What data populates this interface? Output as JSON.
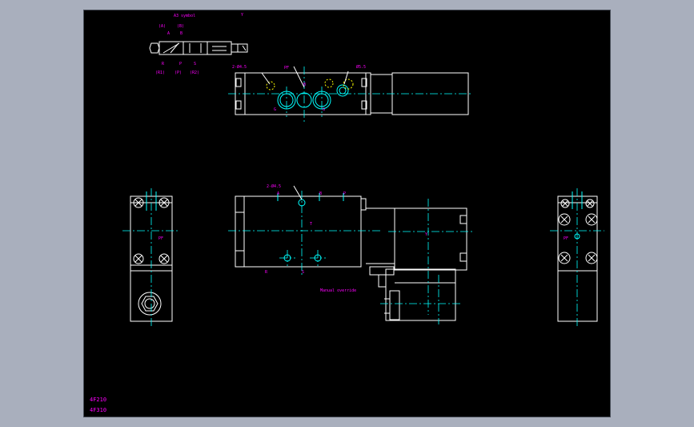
{
  "labels": {
    "symbol_pilot": "A3 symbol",
    "symbol_a": "(A)",
    "symbol_b": "(B)",
    "symbol_a2": "A",
    "symbol_b2": "B",
    "symbol_r": "R",
    "symbol_p": "P",
    "symbol_s": "S",
    "symbol_r1": "(R1)",
    "symbol_p1": "(P)",
    "symbol_r2": "(R2)",
    "symbol_y": "Y",
    "top_hole_left": "2-Ø4.5",
    "top_hole_right": "Ø5.5",
    "top_pf": "PF",
    "top_b": "B",
    "top_g1": "G",
    "top_g2": "G",
    "front_holes": "2-Ø4.5",
    "front_a": "A",
    "front_b": "B",
    "front_p": "P",
    "front_r": "R",
    "front_s": "S",
    "front_t": "T",
    "front_y": "Y",
    "manual_note": "Manual override",
    "left_pf": "PF",
    "right_pf": "PF"
  },
  "models": {
    "line1": "4F210",
    "line2": "4F310"
  },
  "colors": {
    "background": "#000000",
    "outline": "#ffffff",
    "centerline": "#00ffff",
    "annotation": "#ff00ff",
    "hidden": "#ffff00",
    "window": "#a9afbd"
  }
}
